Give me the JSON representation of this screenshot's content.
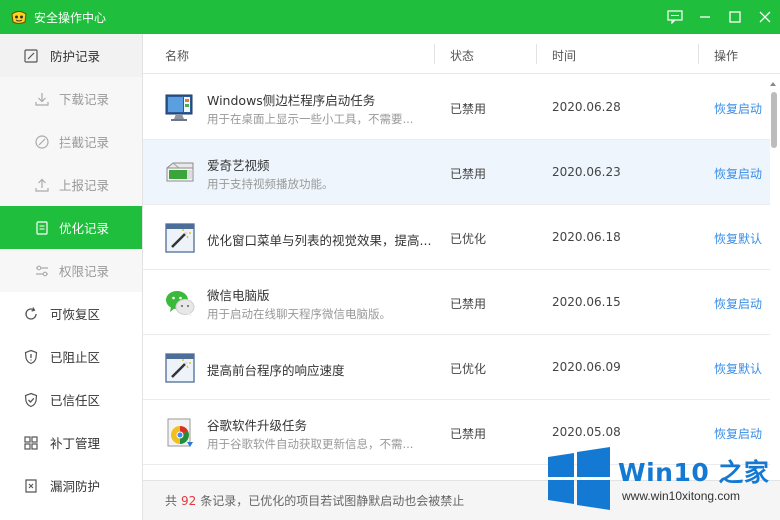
{
  "window": {
    "title": "安全操作中心",
    "colors": {
      "brand": "#1fbe3c",
      "link": "#3a8ee6",
      "count": "#e4393c"
    }
  },
  "sidebar": {
    "items": [
      {
        "label": "防护记录",
        "icon": "shield-record-icon"
      },
      {
        "label": "下载记录",
        "icon": "download-icon"
      },
      {
        "label": "拦截记录",
        "icon": "block-icon"
      },
      {
        "label": "上报记录",
        "icon": "upload-icon"
      },
      {
        "label": "优化记录",
        "icon": "optimize-icon",
        "active": true
      },
      {
        "label": "权限记录",
        "icon": "permission-icon"
      },
      {
        "label": "可恢复区",
        "icon": "restore-icon"
      },
      {
        "label": "已阻止区",
        "icon": "blocked-shield-icon"
      },
      {
        "label": "已信任区",
        "icon": "trusted-shield-icon"
      },
      {
        "label": "补丁管理",
        "icon": "patch-icon"
      },
      {
        "label": "漏洞防护",
        "icon": "vulnerability-icon"
      }
    ]
  },
  "table": {
    "columns": {
      "name": "名称",
      "status": "状态",
      "time": "时间",
      "action": "操作"
    },
    "rows": [
      {
        "name": "Windows侧边栏程序启动任务",
        "desc": "用于在桌面上显示一些小工具，不需要...",
        "status": "已禁用",
        "time": "2020.06.28",
        "action": "恢复启动",
        "icon": "sidebar-monitor-icon"
      },
      {
        "name": "爱奇艺视频",
        "desc": "用于支持视频播放功能。",
        "status": "已禁用",
        "time": "2020.06.23",
        "action": "恢复启动",
        "icon": "video-box-icon"
      },
      {
        "name": "优化窗口菜单与列表的视觉效果，提高...",
        "desc": "",
        "status": "已优化",
        "time": "2020.06.18",
        "action": "恢复默认",
        "icon": "magic-wand-window-icon"
      },
      {
        "name": "微信电脑版",
        "desc": "用于启动在线聊天程序微信电脑版。",
        "status": "已禁用",
        "time": "2020.06.15",
        "action": "恢复启动",
        "icon": "wechat-icon"
      },
      {
        "name": "提高前台程序的响应速度",
        "desc": "",
        "status": "已优化",
        "time": "2020.06.09",
        "action": "恢复默认",
        "icon": "magic-wand-window-icon"
      },
      {
        "name": "谷歌软件升级任务",
        "desc": "用于谷歌软件自动获取更新信息，不需...",
        "status": "已禁用",
        "time": "2020.05.08",
        "action": "恢复启动",
        "icon": "software-update-icon"
      }
    ]
  },
  "footer": {
    "prefix": "共",
    "count": "92",
    "suffix": "条记录，已优化的项目若试图静默启动也会被禁止"
  },
  "watermark": {
    "brand": "Win10 之家",
    "url": "www.win10xitong.com"
  }
}
